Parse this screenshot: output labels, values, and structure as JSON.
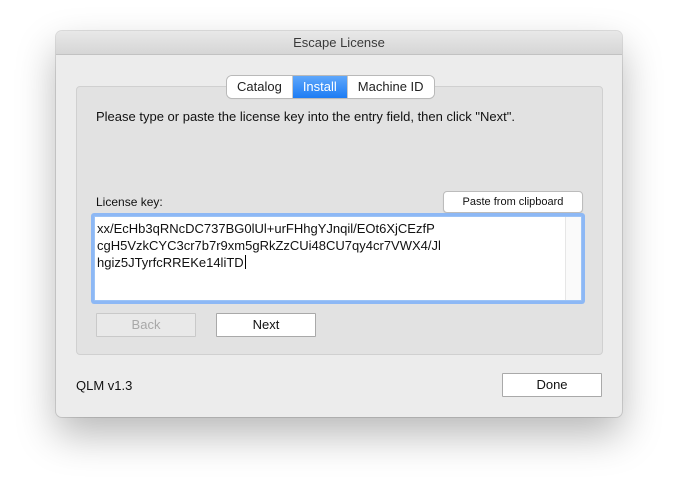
{
  "window": {
    "title": "Escape License"
  },
  "tabs": [
    {
      "label": "Catalog",
      "active": false
    },
    {
      "label": "Install",
      "active": true
    },
    {
      "label": "Machine ID",
      "active": false
    }
  ],
  "install": {
    "instruction": "Please type or paste the license key into the entry field, then click \"Next\".",
    "license_key_label": "License key:",
    "paste_button": "Paste from clipboard",
    "license_key_lines": [
      "xx/EcHb3qRNcDC737BG0lUl+urFHhgYJnqil/EOt6XjCEzfP",
      "cgH5VzkCYC3cr7b7r9xm5gRkZzCUi48CU7qy4cr7VWX4/Jl",
      "hgiz5JTyrfcRREKe14liTD"
    ],
    "back_button": "Back",
    "next_button": "Next"
  },
  "footer": {
    "version": "QLM v1.3",
    "done_button": "Done"
  },
  "colors": {
    "accent": "#1d7cf4",
    "focus_ring": "#8db8f5"
  }
}
